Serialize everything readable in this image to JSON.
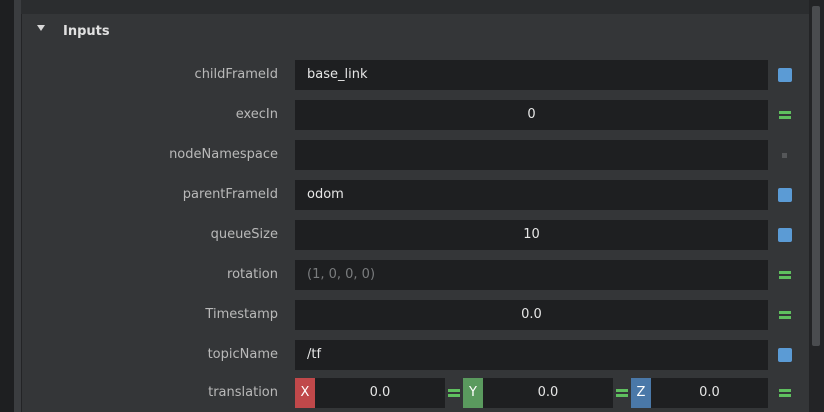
{
  "section": {
    "title": "Inputs"
  },
  "rows": [
    {
      "label": "childFrameId",
      "value": "base_link",
      "align": "left",
      "badge": "blue-square-icon"
    },
    {
      "label": "execIn",
      "value": "0",
      "align": "center",
      "badge": "equals-icon"
    },
    {
      "label": "nodeNamespace",
      "value": "",
      "align": "left",
      "badge": "small-dot-icon"
    },
    {
      "label": "parentFrameId",
      "value": "odom",
      "align": "left",
      "badge": "blue-square-icon"
    },
    {
      "label": "queueSize",
      "value": "10",
      "align": "center",
      "badge": "blue-square-icon"
    },
    {
      "label": "rotation",
      "value": "(1, 0, 0, 0)",
      "align": "left",
      "badge": "equals-icon",
      "placeholder": true
    },
    {
      "label": "Timestamp",
      "value": "0.0",
      "align": "center",
      "badge": "equals-icon"
    },
    {
      "label": "topicName",
      "value": "/tf",
      "align": "left",
      "badge": "blue-square-icon"
    }
  ],
  "translation": {
    "label": "translation",
    "x_label": "X",
    "y_label": "Y",
    "z_label": "Z",
    "x": "0.0",
    "y": "0.0",
    "z": "0.0"
  },
  "colors": {
    "blue_badge": "#5b9bd5",
    "equals_badge": "#5fbf5f",
    "axis_x": "#c0484a",
    "axis_y": "#5a9a5e",
    "axis_z": "#4a78a8"
  }
}
